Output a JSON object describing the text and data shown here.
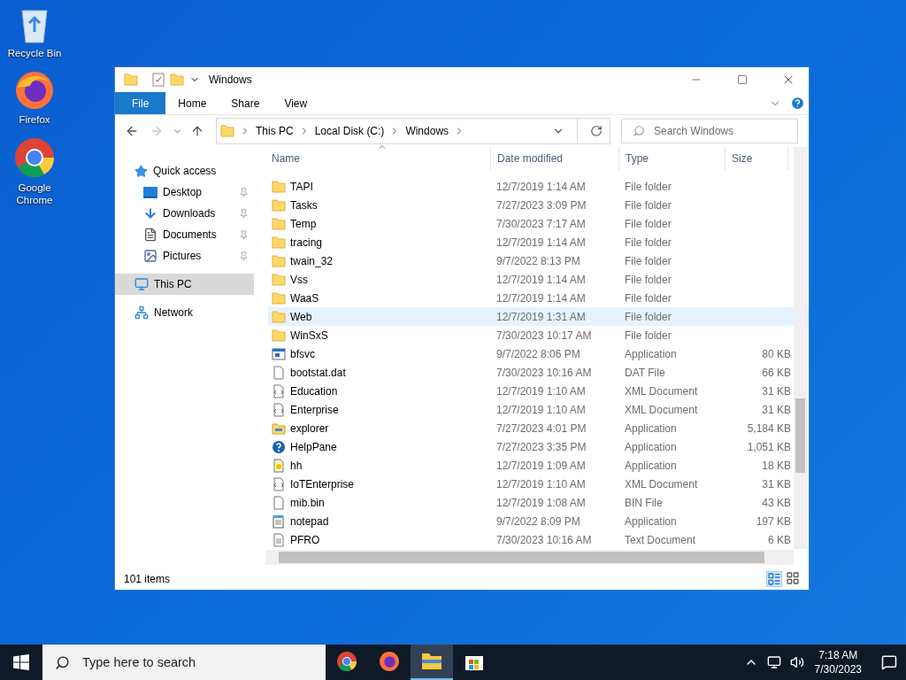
{
  "desktop_icons": [
    {
      "label": "Recycle Bin",
      "kind": "recycle"
    },
    {
      "label": "Firefox",
      "kind": "firefox"
    },
    {
      "label": "Google Chrome",
      "kind": "chrome"
    }
  ],
  "window": {
    "title": "Windows"
  },
  "ribbon_tabs": [
    {
      "label": "File",
      "kind": "menu"
    },
    {
      "label": "Home",
      "kind": "tab"
    },
    {
      "label": "Share",
      "kind": "tab"
    },
    {
      "label": "View",
      "kind": "tab"
    }
  ],
  "address": {
    "crumbs": [
      "This PC",
      "Local Disk (C:)",
      "Windows"
    ]
  },
  "search": {
    "placeholder": "Search Windows"
  },
  "nav": [
    {
      "label": "Quick access",
      "kind": "star",
      "selected": false,
      "children": [
        {
          "label": "Desktop",
          "kind": "desktop",
          "pinned": true,
          "selected": false
        },
        {
          "label": "Downloads",
          "kind": "download",
          "pinned": true,
          "selected": false
        },
        {
          "label": "Documents",
          "kind": "document",
          "pinned": true,
          "selected": false
        },
        {
          "label": "Pictures",
          "kind": "pictures",
          "pinned": true,
          "selected": false
        }
      ]
    },
    {
      "label": "This PC",
      "kind": "pc",
      "selected": true
    },
    {
      "label": "Network",
      "kind": "network",
      "selected": false
    }
  ],
  "columns": [
    "Name",
    "Date modified",
    "Type",
    "Size"
  ],
  "rows": [
    {
      "name": "TAPI",
      "date": "12/7/2019 1:14 AM",
      "type": "File folder",
      "kind": "folder",
      "selected": false
    },
    {
      "name": "Tasks",
      "date": "7/27/2023 3:09 PM",
      "type": "File folder",
      "kind": "folder",
      "selected": false
    },
    {
      "name": "Temp",
      "date": "7/30/2023 7:17 AM",
      "type": "File folder",
      "kind": "folder",
      "selected": false
    },
    {
      "name": "tracing",
      "date": "12/7/2019 1:14 AM",
      "type": "File folder",
      "kind": "folder",
      "selected": false
    },
    {
      "name": "twain_32",
      "date": "9/7/2022 8:13 PM",
      "type": "File folder",
      "kind": "folder",
      "selected": false
    },
    {
      "name": "Vss",
      "date": "12/7/2019 1:14 AM",
      "type": "File folder",
      "kind": "folder",
      "selected": false
    },
    {
      "name": "WaaS",
      "date": "12/7/2019 1:14 AM",
      "type": "File folder",
      "kind": "folder",
      "selected": false
    },
    {
      "name": "Web",
      "date": "12/7/2019 1:31 AM",
      "type": "File folder",
      "kind": "folder",
      "selected": true
    },
    {
      "name": "WinSxS",
      "date": "7/30/2023 10:17 AM",
      "type": "File folder",
      "kind": "folder",
      "selected": false
    },
    {
      "name": "bfsvc",
      "date": "9/7/2022 8:06 PM",
      "type": "Application",
      "size": "80 KB",
      "kind": "app",
      "selected": false
    },
    {
      "name": "bootstat.dat",
      "date": "7/30/2023 10:16 AM",
      "type": "DAT File",
      "size": "66 KB",
      "kind": "blank",
      "selected": false
    },
    {
      "name": "Education",
      "date": "12/7/2019 1:10 AM",
      "type": "XML Document",
      "size": "31 KB",
      "kind": "xml",
      "selected": false
    },
    {
      "name": "Enterprise",
      "date": "12/7/2019 1:10 AM",
      "type": "XML Document",
      "size": "31 KB",
      "kind": "xml",
      "selected": false
    },
    {
      "name": "explorer",
      "date": "7/27/2023 4:01 PM",
      "type": "Application",
      "size": "5,184 KB",
      "kind": "explorer",
      "selected": false
    },
    {
      "name": "HelpPane",
      "date": "7/27/2023 3:35 PM",
      "type": "Application",
      "size": "1,051 KB",
      "kind": "help",
      "selected": false
    },
    {
      "name": "hh",
      "date": "12/7/2019 1:09 AM",
      "type": "Application",
      "size": "18 KB",
      "kind": "hh",
      "selected": false
    },
    {
      "name": "IoTEnterprise",
      "date": "12/7/2019 1:10 AM",
      "type": "XML Document",
      "size": "31 KB",
      "kind": "xml",
      "selected": false
    },
    {
      "name": "mib.bin",
      "date": "12/7/2019 1:08 AM",
      "type": "BIN File",
      "size": "43 KB",
      "kind": "blank",
      "selected": false
    },
    {
      "name": "notepad",
      "date": "9/7/2022 8:09 PM",
      "type": "Application",
      "size": "197 KB",
      "kind": "notepad",
      "selected": false
    },
    {
      "name": "PFRO",
      "date": "7/30/2023 10:16 AM",
      "type": "Text Document",
      "size": "6 KB",
      "kind": "text",
      "selected": false
    }
  ],
  "status": "101 items",
  "taskbar": {
    "search_placeholder": "Type here to search",
    "apps": [
      {
        "kind": "chrome",
        "active": false
      },
      {
        "kind": "firefox",
        "active": false
      },
      {
        "kind": "explorer",
        "active": true
      },
      {
        "kind": "store",
        "active": false
      }
    ],
    "time": "7:18 AM",
    "date": "7/30/2023"
  }
}
